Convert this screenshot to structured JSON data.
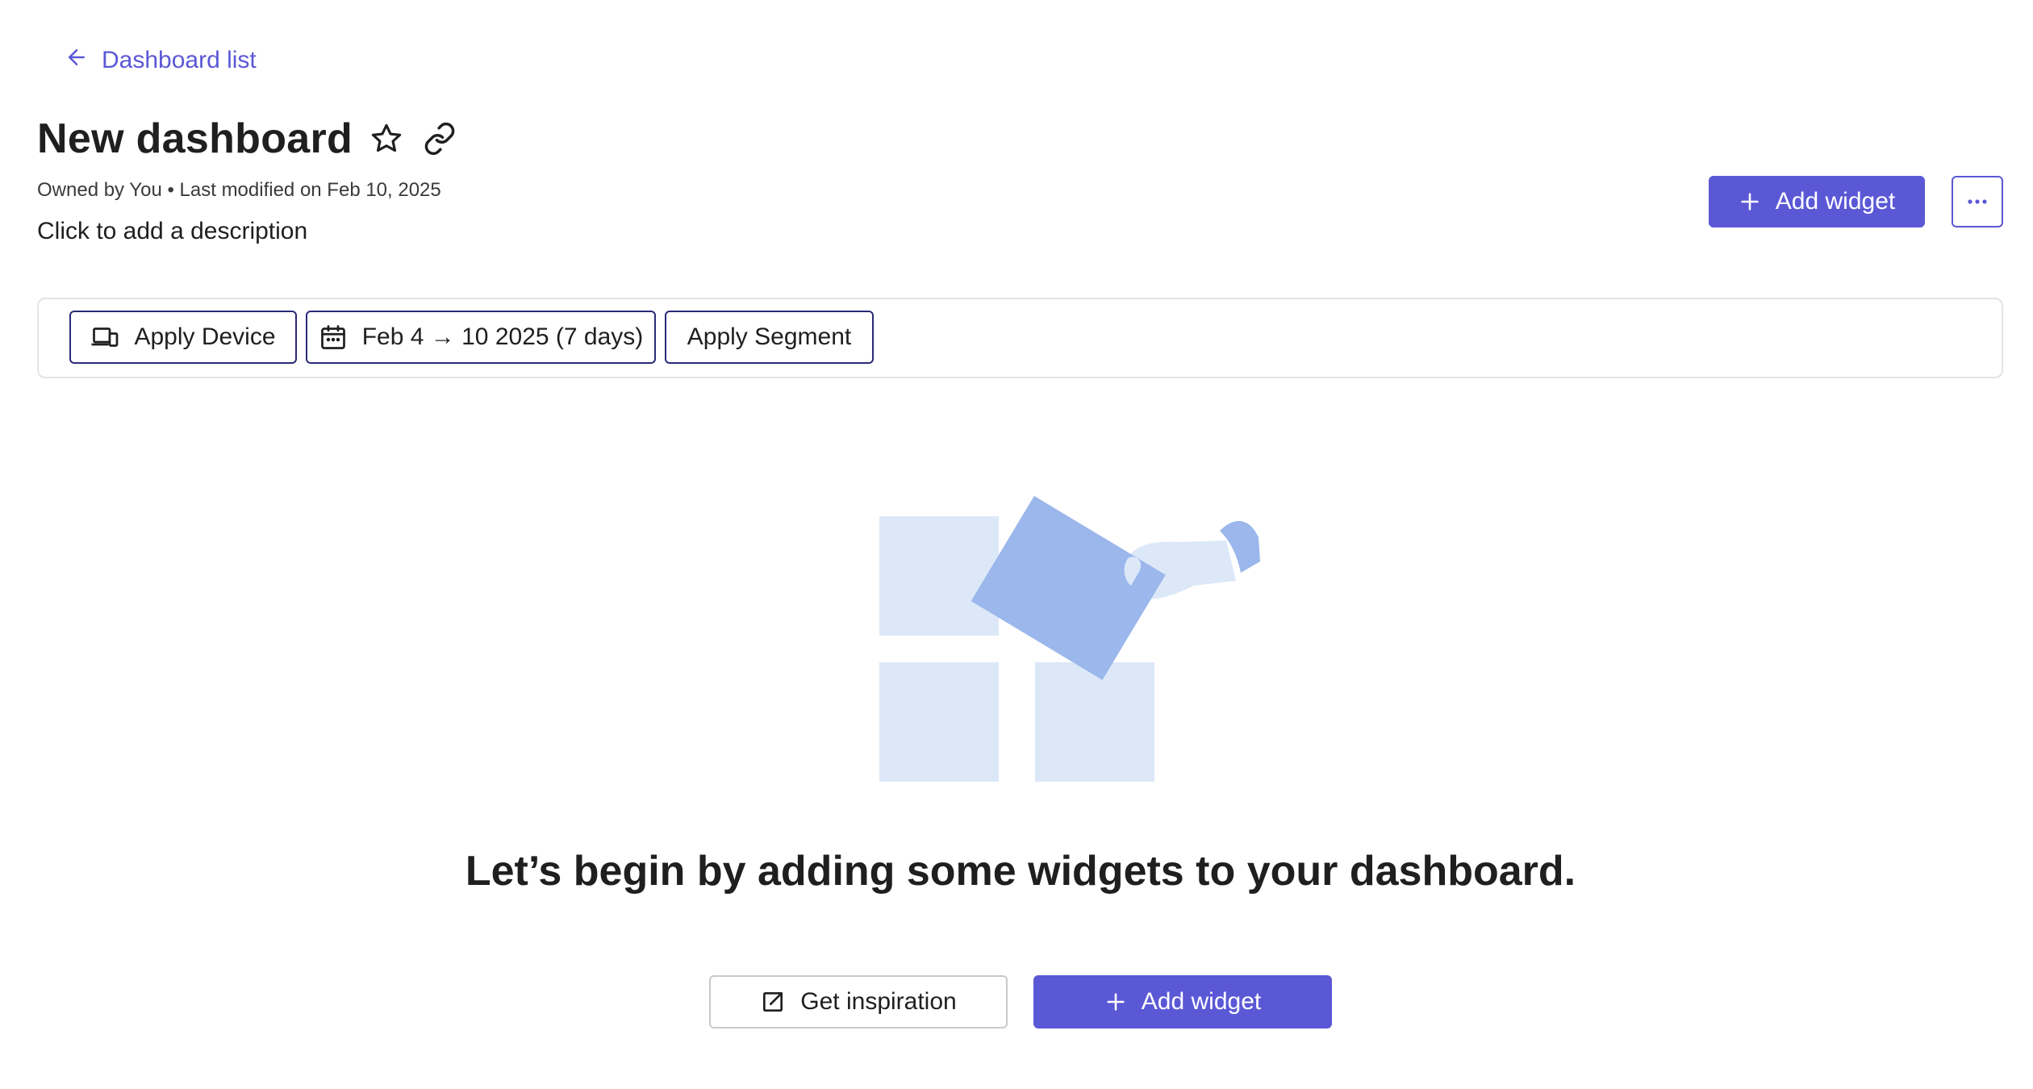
{
  "back_link": {
    "label": "Dashboard list",
    "icon": "arrow-left-icon"
  },
  "header": {
    "title": "New dashboard",
    "meta": "Owned by You • Last modified on Feb 10, 2025",
    "description": "Click to add a description",
    "add_widget_label": "Add widget"
  },
  "filters": {
    "device_label": "Apply Device",
    "date_range_label": "Feb 4 → 10 2025 (7 days)",
    "segment_label": "Apply Segment"
  },
  "empty_state": {
    "heading": "Let’s begin by adding some widgets to your dashboard.",
    "inspiration_label": "Get inspiration",
    "add_widget_label": "Add widget"
  },
  "colors": {
    "accent": "#5b58d6",
    "filter_border": "#2b2a77",
    "illustration_light": "#dce8f8",
    "illustration_dark": "#9bb7ec"
  }
}
